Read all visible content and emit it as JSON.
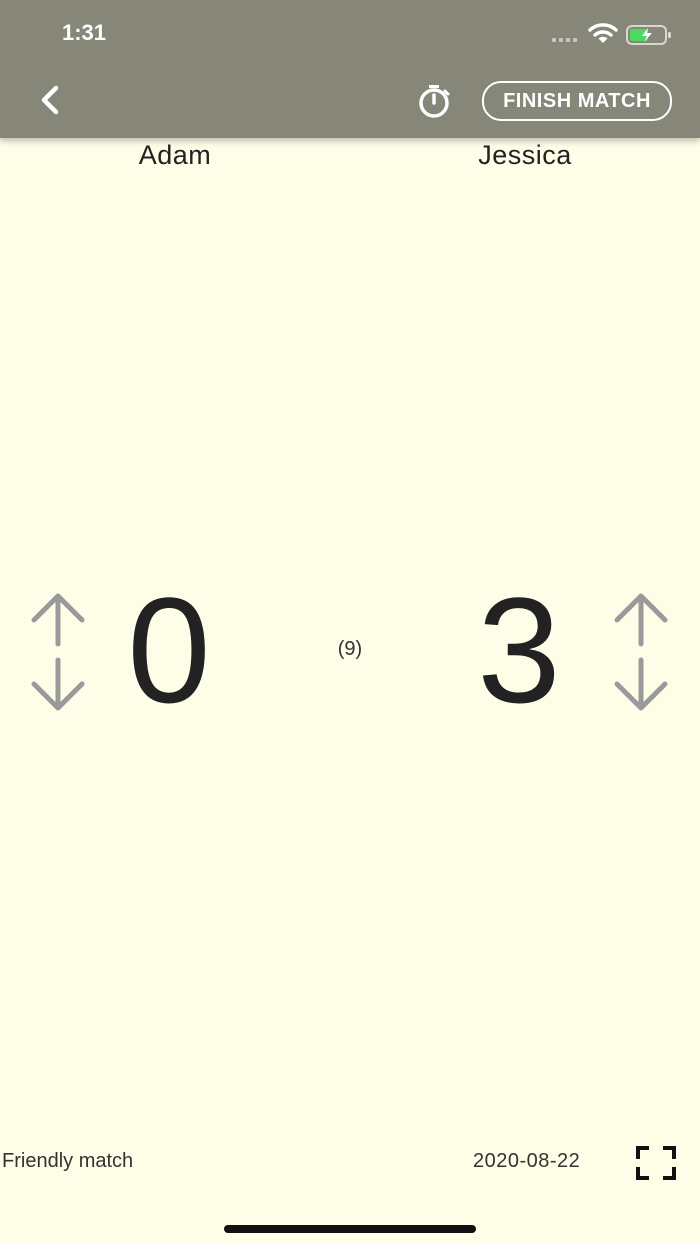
{
  "status_bar": {
    "time": "1:31"
  },
  "header": {
    "finish_label": "FINISH MATCH",
    "icons": {
      "back": "chevron-left-icon",
      "timer": "stopwatch-icon"
    }
  },
  "players": {
    "left": {
      "name": "Adam",
      "score": "0"
    },
    "right": {
      "name": "Jessica",
      "score": "3"
    }
  },
  "middle_value": "(9)",
  "footer": {
    "match_type": "Friendly match",
    "date": "2020-08-22",
    "icon": "fullscreen-icon"
  },
  "colors": {
    "header_bg": "#868679",
    "page_bg": "#fdfde8",
    "arrow": "#9a9a9a",
    "battery": "#4cd964"
  }
}
